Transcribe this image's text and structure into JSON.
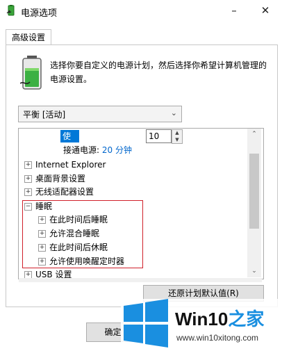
{
  "window": {
    "title": "电源选项",
    "minimize": "–",
    "close": "✕"
  },
  "tabs": [
    {
      "label": "高级设置"
    }
  ],
  "description": "选择你要自定义的电源计划，然后选择你希望计算机管理的电源设置。",
  "plan": {
    "selected": "平衡 [活动]"
  },
  "tree": {
    "battery": {
      "label": "使用电池(分钟):",
      "value": "10"
    },
    "plugged": {
      "label": "接通电源:",
      "value": "20 分钟"
    },
    "items": [
      {
        "label": "Internet Explorer",
        "expander": "⊞"
      },
      {
        "label": "桌面背景设置",
        "expander": "⊞"
      },
      {
        "label": "无线适配器设置",
        "expander": "⊞"
      },
      {
        "label": "睡眠",
        "expander": "⊟"
      },
      {
        "label": "在此时间后睡眠",
        "expander": "⊞"
      },
      {
        "label": "允许混合睡眠",
        "expander": "⊞"
      },
      {
        "label": "在此时间后休眠",
        "expander": "⊞"
      },
      {
        "label": "允许使用唤醒定时器",
        "expander": "⊞"
      },
      {
        "label": "USB 设置",
        "expander": "⊞"
      }
    ]
  },
  "buttons": {
    "restore": "还原计划默认值(R)",
    "ok": "确定"
  },
  "watermark": {
    "brand_prefix": "Win10",
    "brand_suffix": "之家",
    "url": "www.win10xitong.com"
  },
  "colors": {
    "selection": "#0078d7",
    "link": "#0066cc",
    "highlight_border": "#d0202a",
    "watermark_blue": "#1a8fe0"
  },
  "icons": {
    "app": "battery-power-icon",
    "minimize": "minimize-icon",
    "close": "close-icon",
    "chevron": "chevron-down-icon",
    "logo": "windows-logo-icon"
  }
}
